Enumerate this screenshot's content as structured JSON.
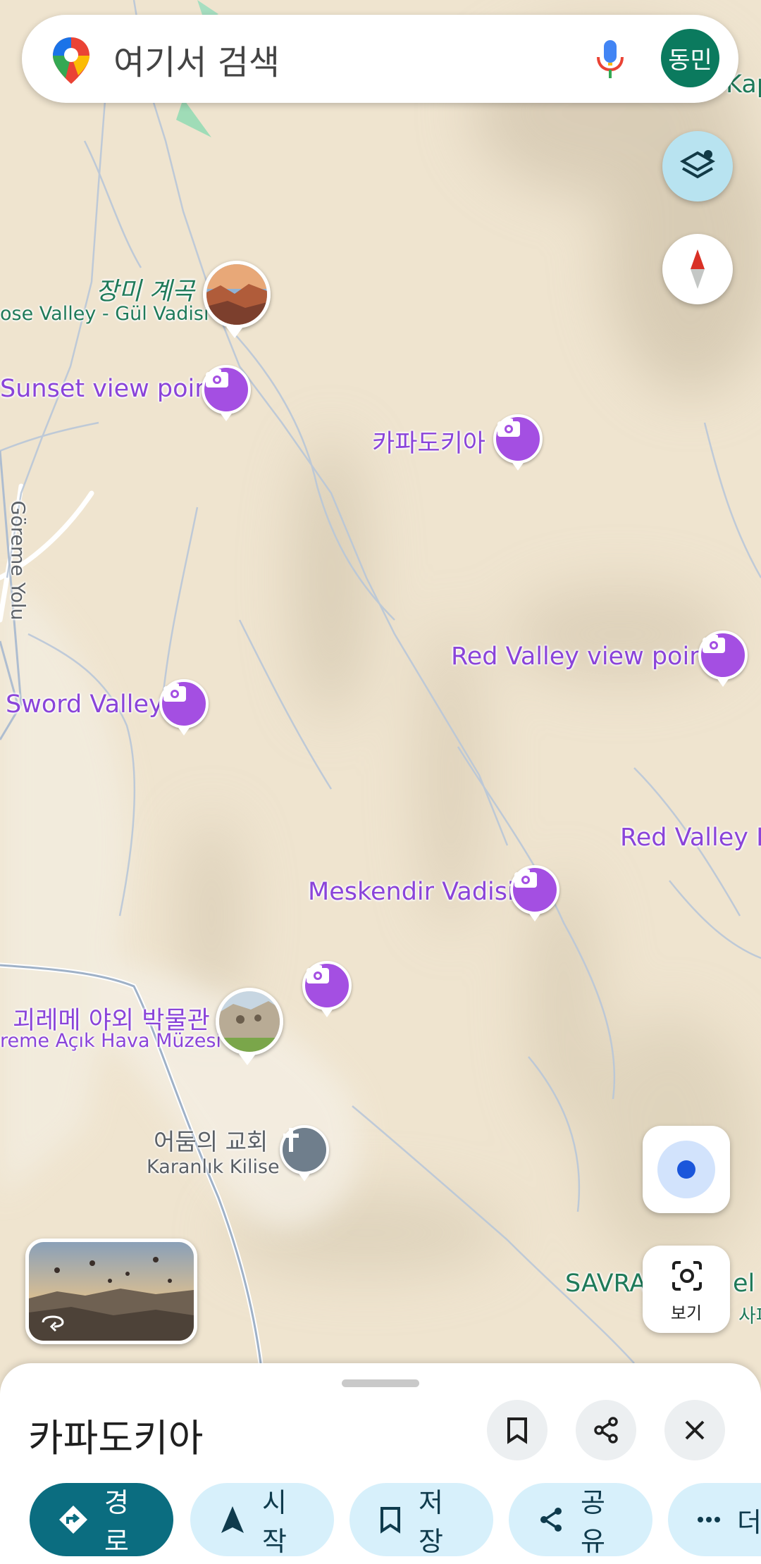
{
  "search": {
    "placeholder": "여기서 검색",
    "avatar_text": "동민"
  },
  "map_labels": {
    "rose_valley_ko": "장미 계곡",
    "rose_valley_tr": "ose Valley - Gül Vadisi",
    "sunset": "Sunset view point",
    "cappadocia": "카파도키아",
    "goreme_yolu": "Göreme Yolu",
    "red_valley_vp": "Red Valley view point",
    "sword_valley": "Sword Valley",
    "red_valley_p": "Red Valley P",
    "meskendir": "Meskendir Vadisi",
    "goreme_museum_ko": "괴레메 야외 박물관",
    "goreme_museum_tr": "reme Açık Hava Müzesi",
    "dark_church_ko": "어둠의 교회",
    "dark_church_tr": "Karanlık Kilise",
    "savra": "SAVRA",
    "savra_tail": "el S",
    "savra_sub": "사파",
    "kap": "Kap"
  },
  "controls": {
    "lens_label": "보기"
  },
  "sheet": {
    "title": "카파도키아",
    "chips": {
      "directions": "경로",
      "start": "시작",
      "save": "저장",
      "share": "공유",
      "more": "더"
    }
  },
  "colors": {
    "poi": "#a44fe2",
    "primary": "#0b6d80",
    "chip": "#d7f0fb",
    "map": "#efe4cf"
  }
}
